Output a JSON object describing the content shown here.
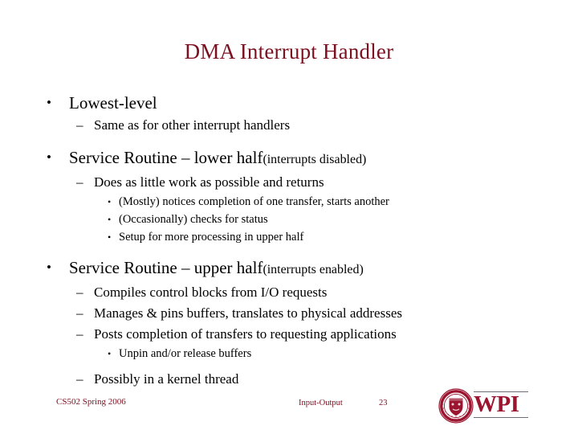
{
  "slide": {
    "title": "DMA Interrupt Handler",
    "title_color": "#7B1020",
    "body_color": "#000000",
    "background": "#ffffff",
    "markers": {
      "level1": "•",
      "level2": "–",
      "level3": "•"
    },
    "bullets": [
      {
        "level": 1,
        "text": "Lowest-level",
        "note": ""
      },
      {
        "level": 2,
        "text": "Same as for other interrupt handlers",
        "note": ""
      },
      {
        "level": 1,
        "text": "Service Routine – lower half ",
        "note": "(interrupts disabled)"
      },
      {
        "level": 2,
        "text": "Does as little work as possible and returns",
        "note": ""
      },
      {
        "level": 3,
        "text": "(Mostly) notices completion of one transfer, starts another",
        "note": ""
      },
      {
        "level": 3,
        "text": "(Occasionally) checks for status",
        "note": ""
      },
      {
        "level": 3,
        "text": "Setup for more processing in upper half",
        "note": ""
      },
      {
        "level": 1,
        "text": "Service Routine – upper half ",
        "note": "(interrupts enabled)"
      },
      {
        "level": 2,
        "text": "Compiles control blocks from I/O requests",
        "note": ""
      },
      {
        "level": 2,
        "text": "Manages & pins buffers, translates to physical addresses",
        "note": ""
      },
      {
        "level": 2,
        "text": "Posts completion of transfers to requesting applications",
        "note": ""
      },
      {
        "level": 3,
        "text": "Unpin and/or release buffers",
        "note": ""
      },
      {
        "level": 2,
        "text": "Possibly in a kernel thread",
        "note": ""
      }
    ]
  },
  "footer": {
    "left": "CS502 Spring 2006",
    "center": "Input-Output",
    "page_number": "23",
    "color": "#7B1020"
  },
  "logo": {
    "wordmark": "WPI",
    "seal_text": "WORCESTER POLYTECHNIC INSTITUTE",
    "seal_year": "1865",
    "primary_color": "#9C1530",
    "seal_ring_color": "#9C1530"
  }
}
